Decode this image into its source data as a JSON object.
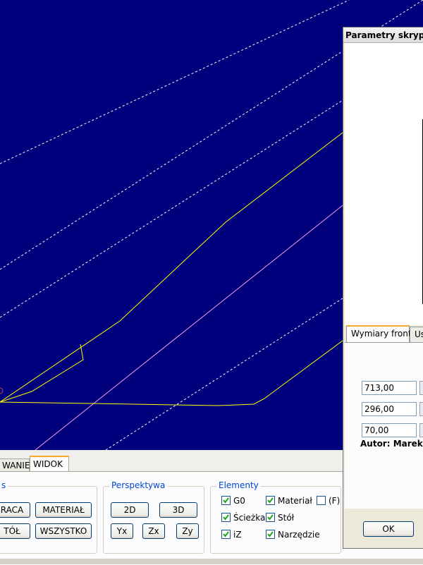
{
  "colors": {
    "viewport_bg": "#00007d",
    "toolpath": "#ffff00",
    "guide_dashed": "#ffffff",
    "guide_pink": "#ff9be6",
    "accent_tab": "#f9a928",
    "group_title": "#0046d5"
  },
  "tabs": [
    {
      "label": "WANIE"
    },
    {
      "label": "WIDOK"
    }
  ],
  "groups": {
    "left": {
      "title": "s",
      "buttons": [
        "RACA",
        "MATERIAŁ",
        "TÓŁ",
        "WSZYSTKO"
      ]
    },
    "perspective": {
      "title": "Perspektywa",
      "buttons": [
        "2D",
        "3D",
        "Yx",
        "Zx",
        "Zy"
      ]
    },
    "elements": {
      "title": "Elementy",
      "checkboxes": [
        {
          "label": "G0",
          "checked": true
        },
        {
          "label": "Materiał",
          "checked": true
        },
        {
          "label": "(F)",
          "checked": false
        },
        {
          "label": "Ścieżka",
          "checked": true
        },
        {
          "label": "Stół",
          "checked": true
        },
        {
          "label": "iZ",
          "checked": true
        },
        {
          "label": "Narzędzie",
          "checked": true
        }
      ]
    }
  },
  "dialog": {
    "title": "Parametry skryptu",
    "tabs": [
      "Wymiary frontu",
      "Ust"
    ],
    "inputs": [
      "713,00",
      "296,00",
      "70,00"
    ],
    "author": "Autor: Marek Mi",
    "ok_label": "OK"
  }
}
